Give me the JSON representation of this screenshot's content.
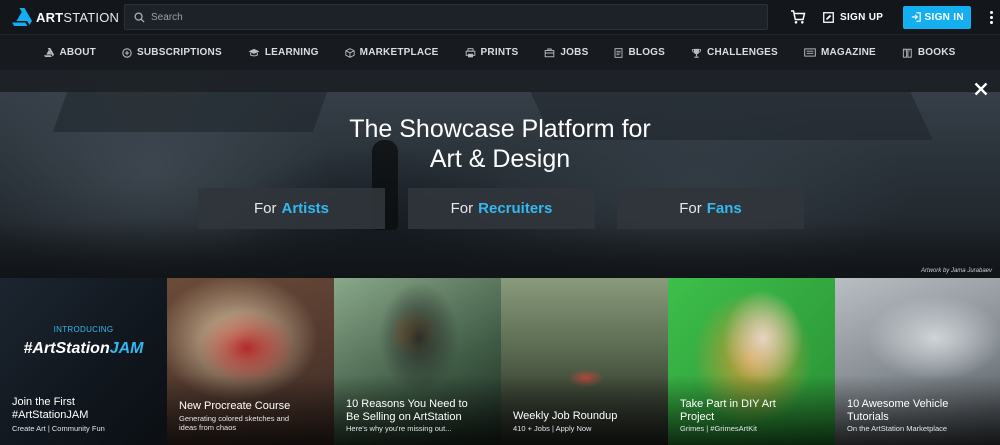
{
  "header": {
    "logo_bold": "ART",
    "logo_rest": "STATION",
    "search_placeholder": "Search",
    "signup_label": "SIGN UP",
    "signin_label": "SIGN IN",
    "icons": [
      "artstation-logo-icon",
      "search-icon",
      "cart-icon",
      "edit-icon",
      "login-icon",
      "more-vertical-icon"
    ]
  },
  "nav": {
    "items": [
      {
        "label": "ABOUT",
        "icon": "artstation-small-icon"
      },
      {
        "label": "SUBSCRIPTIONS",
        "icon": "plus-circle-icon"
      },
      {
        "label": "LEARNING",
        "icon": "graduation-cap-icon"
      },
      {
        "label": "MARKETPLACE",
        "icon": "cube-icon"
      },
      {
        "label": "PRINTS",
        "icon": "print-icon"
      },
      {
        "label": "JOBS",
        "icon": "briefcase-icon"
      },
      {
        "label": "BLOGS",
        "icon": "document-icon"
      },
      {
        "label": "CHALLENGES",
        "icon": "trophy-icon"
      },
      {
        "label": "MAGAZINE",
        "icon": "magazine-icon"
      },
      {
        "label": "BOOKS",
        "icon": "book-icon"
      }
    ]
  },
  "hero": {
    "title_line1": "The Showcase Platform for",
    "title_line2": "Art & Design",
    "buttons": [
      {
        "prefix": "For",
        "highlight": "Artists"
      },
      {
        "prefix": "For",
        "highlight": "Recruiters"
      },
      {
        "prefix": "For",
        "highlight": "Fans"
      }
    ],
    "credit": "Artwork by Jama Jurabaev"
  },
  "cards": [
    {
      "intro": "INTRODUCING",
      "jam_prefix": "#ArtStation",
      "jam_highlight": "JAM",
      "title_line1": "Join the First",
      "title_line2": "#ArtStationJAM",
      "sub_line1": "Create Art | Community Fun",
      "sub_line2": ""
    },
    {
      "title_line1": "New Procreate Course",
      "title_line2": "",
      "sub_line1": "Generating colored sketches and",
      "sub_line2": "ideas from chaos"
    },
    {
      "title_line1": "10 Reasons You Need to",
      "title_line2": "Be Selling on ArtStation",
      "sub_line1": "Here's why you're missing out...",
      "sub_line2": ""
    },
    {
      "title_line1": "Weekly Job Roundup",
      "title_line2": "",
      "sub_line1": "410 + Jobs | Apply Now",
      "sub_line2": ""
    },
    {
      "title_line1": "Take Part in DIY Art",
      "title_line2": "Project",
      "sub_line1": "Grimes | #GrimesArtKit",
      "sub_line2": ""
    },
    {
      "title_line1": "10 Awesome Vehicle",
      "title_line2": "Tutorials",
      "sub_line1": "On the ArtStation Marketplace",
      "sub_line2": ""
    }
  ],
  "colors": {
    "accent": "#13aff0",
    "highlight": "#33b8f0",
    "background": "#13171c"
  }
}
